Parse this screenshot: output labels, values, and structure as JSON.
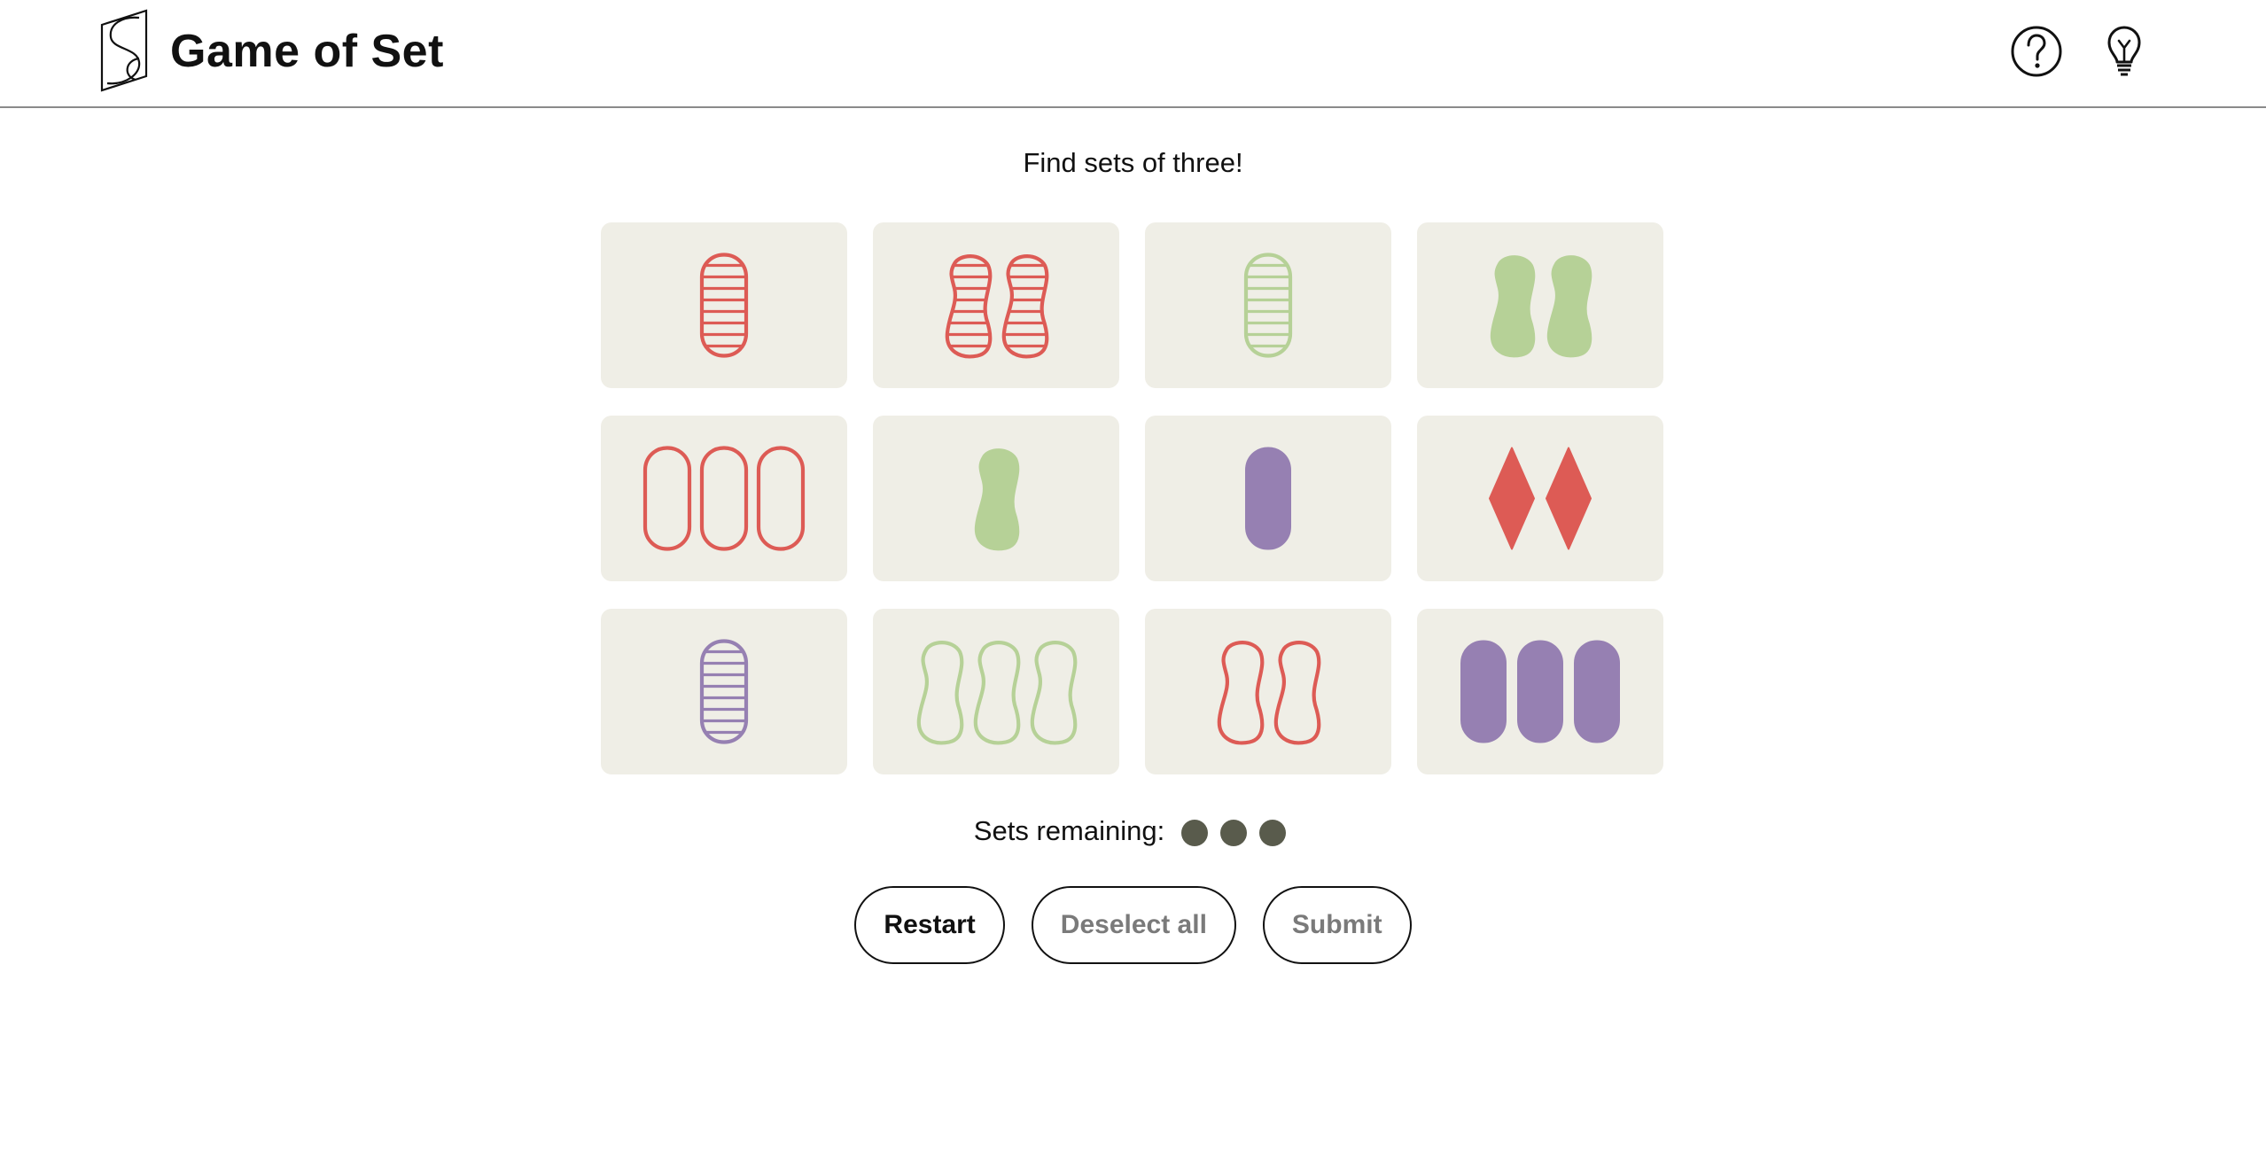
{
  "app": {
    "title": "Game of Set"
  },
  "header": {
    "help_icon": "question-circle-icon",
    "hint_icon": "lightbulb-icon"
  },
  "prompt": "Find sets of three!",
  "colors": {
    "red": "#dd5b55",
    "green": "#b6d197",
    "purple": "#9680b2",
    "card_bg": "#efeee6",
    "dot": "#595b4c"
  },
  "cards": [
    {
      "count": 1,
      "shape": "oval",
      "fill": "striped",
      "color": "red"
    },
    {
      "count": 2,
      "shape": "squiggle",
      "fill": "striped",
      "color": "red"
    },
    {
      "count": 1,
      "shape": "oval",
      "fill": "striped",
      "color": "green"
    },
    {
      "count": 2,
      "shape": "squiggle",
      "fill": "solid",
      "color": "green"
    },
    {
      "count": 3,
      "shape": "oval",
      "fill": "open",
      "color": "red"
    },
    {
      "count": 1,
      "shape": "squiggle",
      "fill": "solid",
      "color": "green"
    },
    {
      "count": 1,
      "shape": "oval",
      "fill": "solid",
      "color": "purple"
    },
    {
      "count": 2,
      "shape": "diamond",
      "fill": "solid",
      "color": "red"
    },
    {
      "count": 1,
      "shape": "oval",
      "fill": "striped",
      "color": "purple"
    },
    {
      "count": 3,
      "shape": "squiggle",
      "fill": "open",
      "color": "green"
    },
    {
      "count": 2,
      "shape": "squiggle",
      "fill": "open",
      "color": "red"
    },
    {
      "count": 3,
      "shape": "oval",
      "fill": "solid",
      "color": "purple"
    }
  ],
  "sets_remaining": {
    "label": "Sets remaining:",
    "count": 3
  },
  "buttons": {
    "restart": "Restart",
    "deselect_all": "Deselect all",
    "submit": "Submit"
  }
}
